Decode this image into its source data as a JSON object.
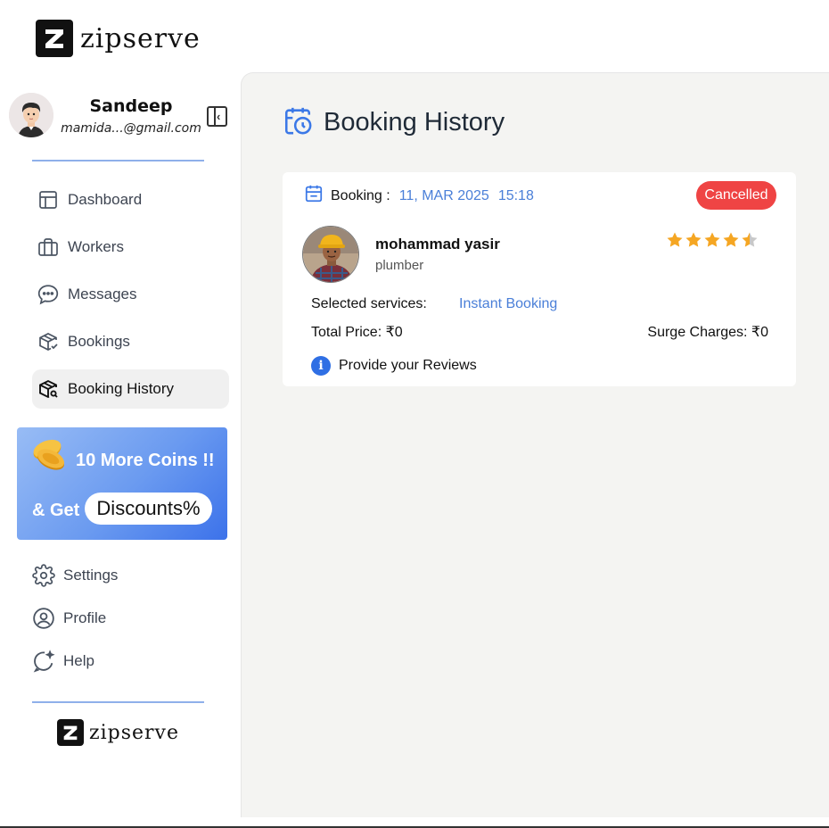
{
  "brand": {
    "name": "zipserve"
  },
  "user": {
    "name": "Sandeep",
    "email": "mamida...@gmail.com"
  },
  "sidebar": {
    "items": [
      {
        "label": "Dashboard",
        "icon": "dashboard-icon"
      },
      {
        "label": "Workers",
        "icon": "briefcase-icon"
      },
      {
        "label": "Messages",
        "icon": "chat-icon"
      },
      {
        "label": "Bookings",
        "icon": "package-check-icon"
      },
      {
        "label": "Booking History",
        "icon": "package-search-icon",
        "active": true
      }
    ],
    "bottom_items": [
      {
        "label": "Settings",
        "icon": "gear-icon"
      },
      {
        "label": "Profile",
        "icon": "user-circle-icon"
      },
      {
        "label": "Help",
        "icon": "help-chat-icon"
      }
    ]
  },
  "promo": {
    "coins_text": "10 More Coins !!",
    "get_text": "& Get",
    "discount_text": "Discounts%"
  },
  "main": {
    "title": "Booking History",
    "booking": {
      "label": "Booking :",
      "date": "11, MAR 2025",
      "time": "15:18",
      "status": "Cancelled",
      "worker_name": "mohammad yasir",
      "worker_role": "plumber",
      "rating": 4.5,
      "services_label": "Selected services:",
      "services_value": "Instant Booking",
      "total_price": "Total Price: ₹0",
      "surge_charges": "Surge Charges: ₹0",
      "review_label": "Provide your Reviews"
    }
  },
  "colors": {
    "accent": "#4a7fd8",
    "status_cancelled": "#ef4444",
    "star": "#f5a623",
    "promo": "#6a9af0"
  }
}
